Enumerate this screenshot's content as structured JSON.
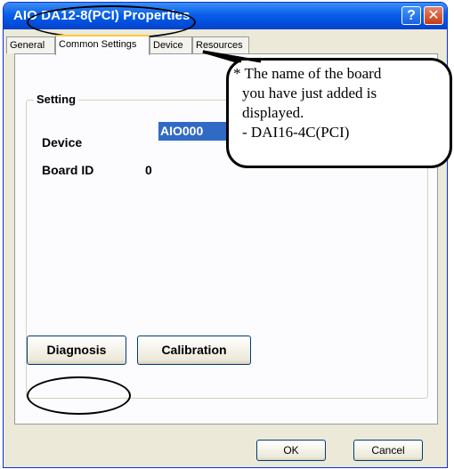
{
  "window": {
    "title": "AIO DA12-8(PCI) Properties",
    "help_glyph": "?",
    "close_glyph": "✕"
  },
  "tabs": [
    {
      "label": "General"
    },
    {
      "label": "Common Settings"
    },
    {
      "label": "Device"
    },
    {
      "label": "Resources"
    }
  ],
  "setting": {
    "group_title": "Setting",
    "device_label": "Device",
    "device_value": "AIO000",
    "board_id_label": "Board ID",
    "board_id_value": "0"
  },
  "buttons": {
    "diagnosis": "Diagnosis",
    "calibration": "Calibration",
    "ok": "OK",
    "cancel": "Cancel"
  },
  "callout": {
    "lines": [
      "* The name of the board",
      "you have just added is",
      "displayed.",
      "- DAI16-4C(PCI)"
    ]
  },
  "colors": {
    "title_bar": "#0a5ee8",
    "selection": "#316ac5",
    "window_bg": "#ece9d8"
  }
}
